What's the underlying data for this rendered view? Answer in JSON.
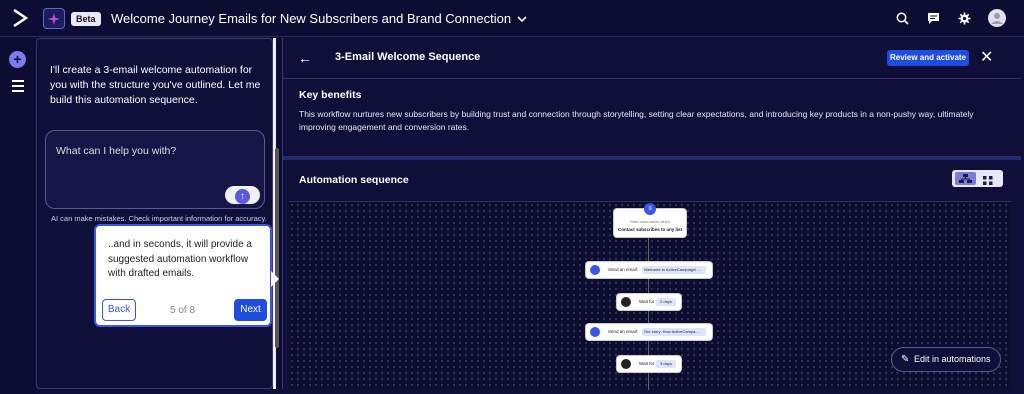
{
  "app": {
    "badge": "Beta",
    "doc_title": "Welcome Journey Emails for New Subscribers and Brand Connection"
  },
  "chat": {
    "message": "I'll create a 3-email welcome automation for you with the structure you've outlined. Let me build this automation sequence.",
    "prompt_placeholder": "What can I help you with?",
    "disclaimer": "AI can make mistakes. Check important information for accuracy."
  },
  "tour": {
    "text": "..and in seconds, it will provide a suggested automation workflow with drafted emails.",
    "back_label": "Back",
    "progress": "5 of 8",
    "next_label": "Next"
  },
  "panel": {
    "title": "3-Email Welcome Sequence",
    "review_label": "Review and activate",
    "key_benefits_title": "Key benefits",
    "key_benefits_text": "This workflow nurtures new subscribers by building trust and connection through storytelling, setting clear expectations, and introducing key products in a non-pushy way, ultimately improving engagement and conversion rates.",
    "sequence_title": "Automation sequence",
    "edit_label": "Edit in automations"
  },
  "flow": {
    "start_line1": "Start automation when",
    "start_line2": "Contact subscribes to any list",
    "email1_label": "Send an email:",
    "email1_value": "Welcome to ActiveCampaign! ...",
    "wait1_label": "Wait for",
    "wait1_value": "2 days",
    "email2_label": "Send an email:",
    "email2_value": "Our story: How ActiveCampa...",
    "wait2_label": "Wait for",
    "wait2_value": "3 days"
  },
  "colors": {
    "background": "#0f0f3a",
    "accent": "#1e4de0",
    "tour_border": "#3a56e8"
  }
}
